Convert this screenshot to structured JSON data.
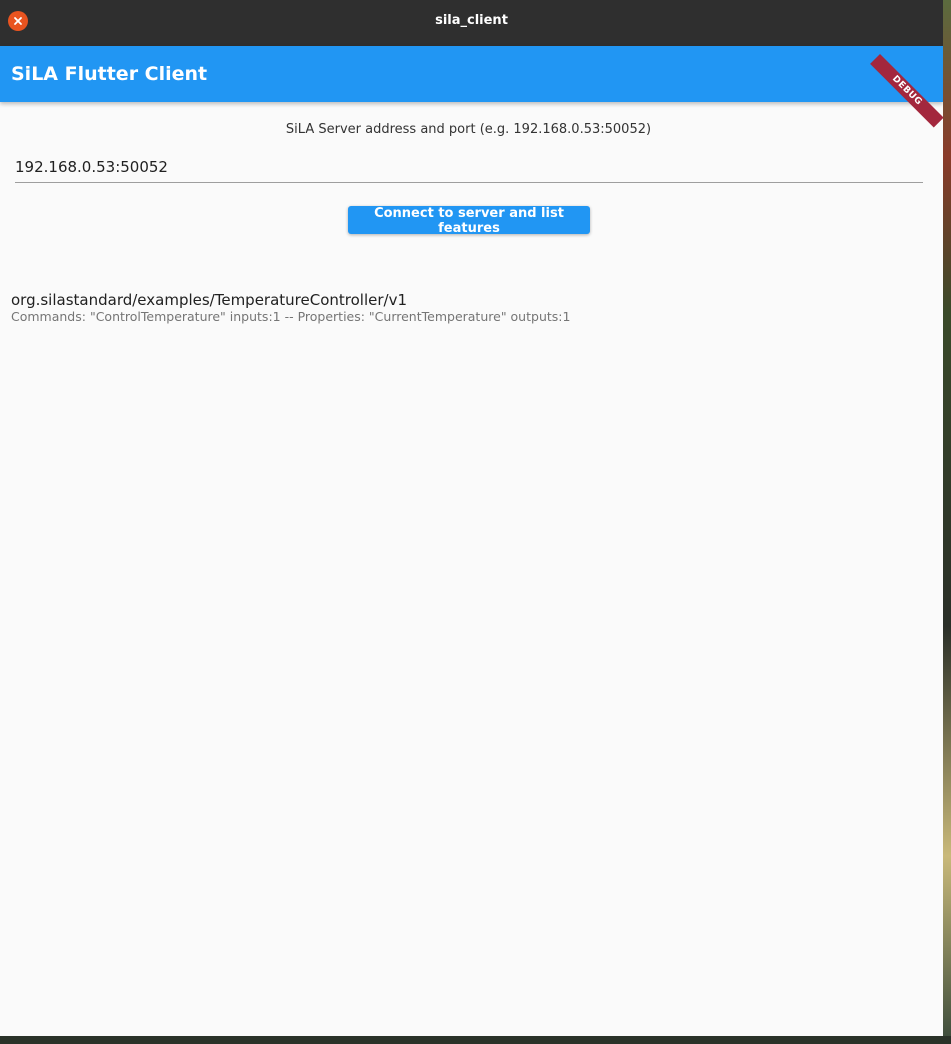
{
  "window": {
    "title": "sila_client"
  },
  "appbar": {
    "title": "SiLA Flutter Client",
    "debug_banner": "DEBUG"
  },
  "connection": {
    "label": "SiLA Server address and port (e.g. 192.168.0.53:50052)",
    "address_value": "192.168.0.53:50052",
    "connect_button_label": "Connect to server and list features"
  },
  "features": [
    {
      "name": "org.silastandard/examples/TemperatureController/v1",
      "details": "Commands: \"ControlTemperature\" inputs:1 -- Properties: \"CurrentTemperature\" outputs:1"
    }
  ],
  "colors": {
    "accent": "#2196f3",
    "titlebar": "#2f2f2f",
    "close_button": "#e95420",
    "debug_banner": "#a3273d",
    "background": "#fafafa"
  }
}
